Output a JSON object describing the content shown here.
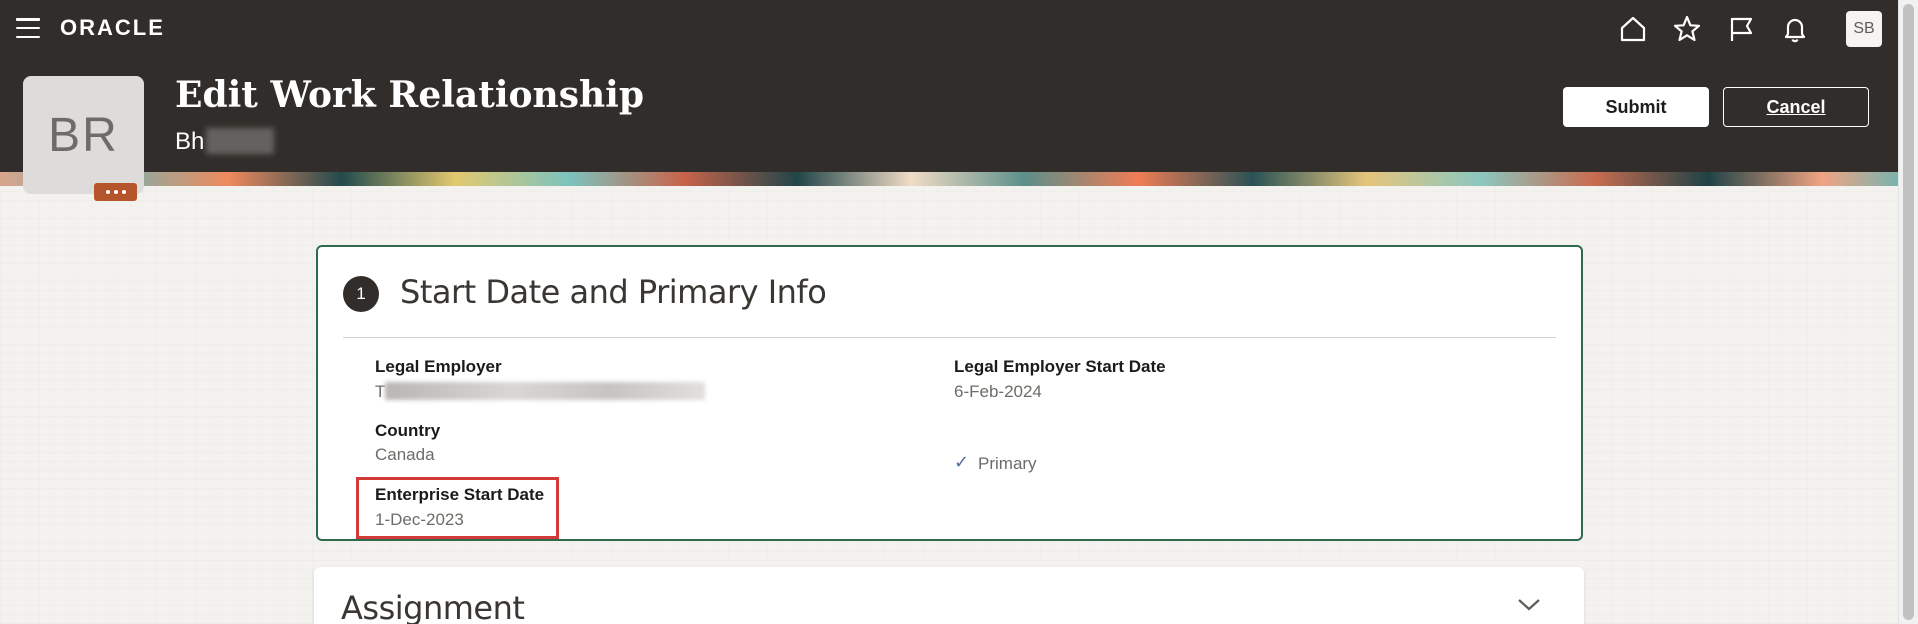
{
  "app": {
    "brand": "ORACLE",
    "user_initials": "SB"
  },
  "nav_icons": [
    "home-icon",
    "favorites-star-icon",
    "flag-icon",
    "notifications-bell-icon"
  ],
  "header": {
    "avatar_initials": "BR",
    "page_title": "Edit Work Relationship",
    "person_name_visible": "Bh",
    "submit_label": "Submit",
    "cancel_label": "Cancel"
  },
  "section": {
    "step_number": "1",
    "title": "Start Date and Primary Info",
    "legal_employer_label": "Legal Employer",
    "legal_employer_value_visible": "T",
    "legal_employer_start_label": "Legal Employer Start Date",
    "legal_employer_start_value": "6-Feb-2024",
    "country_label": "Country",
    "country_value": "Canada",
    "primary_label": "Primary",
    "enterprise_start_label": "Enterprise Start Date",
    "enterprise_start_value": "1-Dec-2023"
  },
  "assignment": {
    "title": "Assignment"
  },
  "colors": {
    "header_bg": "#312d2a",
    "card_border": "#2e6b4d",
    "highlight": "#d23a3a",
    "avatar_action": "#b5552b"
  }
}
